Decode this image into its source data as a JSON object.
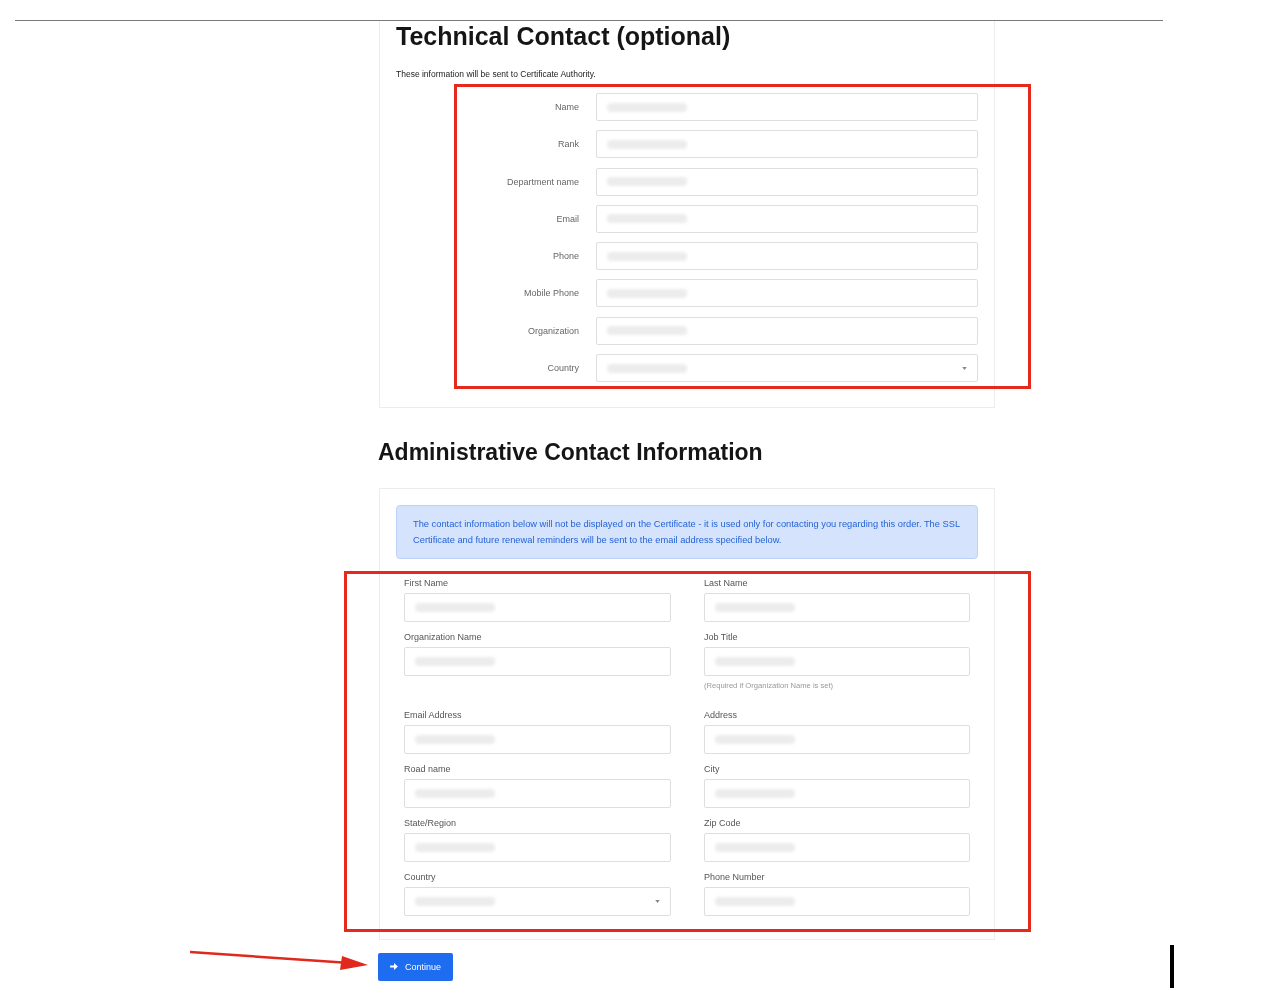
{
  "technical_contact": {
    "title": "Technical Contact (optional)",
    "note": "These information will be sent to Certificate Authority.",
    "highlighted": true,
    "fields": [
      {
        "label": "Name",
        "kind": "text",
        "redacted": true
      },
      {
        "label": "Rank",
        "kind": "text",
        "redacted": true
      },
      {
        "label": "Department name",
        "kind": "text",
        "redacted": true
      },
      {
        "label": "Email",
        "kind": "text",
        "redacted": true
      },
      {
        "label": "Phone",
        "kind": "text",
        "redacted": true
      },
      {
        "label": "Mobile Phone",
        "kind": "text",
        "redacted": true
      },
      {
        "label": "Organization",
        "kind": "text",
        "redacted": true
      },
      {
        "label": "Country",
        "kind": "select",
        "redacted": true
      }
    ]
  },
  "administrative_contact": {
    "title": "Administrative Contact Information",
    "notice": "The contact information below will not be displayed on the Certificate - it is used only for contacting you regarding this order. The SSL Certificate and future renewal reminders will be sent to the email address specified below.",
    "highlighted": true,
    "fields": [
      {
        "label": "First Name",
        "kind": "text",
        "redacted": true
      },
      {
        "label": "Last Name",
        "kind": "text",
        "redacted": true
      },
      {
        "label": "Organization Name",
        "kind": "text",
        "redacted": true
      },
      {
        "label": "Job Title",
        "kind": "text",
        "redacted": true,
        "help": "(Required if Organization Name is set)"
      },
      {
        "label": "Email Address",
        "kind": "text",
        "redacted": true
      },
      {
        "label": "Address",
        "kind": "text",
        "redacted": true
      },
      {
        "label": "Road name",
        "kind": "text",
        "redacted": true
      },
      {
        "label": "City",
        "kind": "text",
        "redacted": true
      },
      {
        "label": "State/Region",
        "kind": "text",
        "redacted": true
      },
      {
        "label": "Zip Code",
        "kind": "text",
        "redacted": true
      },
      {
        "label": "Country",
        "kind": "select",
        "redacted": true
      },
      {
        "label": "Phone Number",
        "kind": "text",
        "redacted": true
      }
    ]
  },
  "continue_button": {
    "label": "Continue",
    "pointed_at": true
  },
  "edge_marker": true
}
